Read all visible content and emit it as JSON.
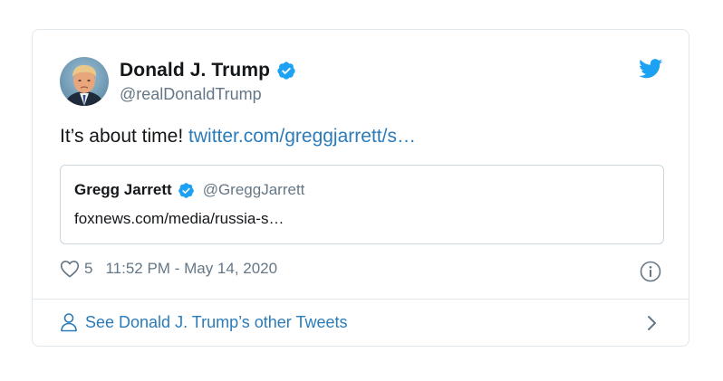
{
  "tweet": {
    "author_name": "Donald J. Trump",
    "author_handle": "@realDonaldTrump",
    "text": "It’s about time! ",
    "link_text": "twitter.com/greggjarrett/s…",
    "likes": "5",
    "timestamp": "11:52 PM - May 14, 2020"
  },
  "quoted": {
    "author_name": "Gregg Jarrett",
    "author_handle": "@GreggJarrett",
    "text": "foxnews.com/media/russia-s…"
  },
  "footer": {
    "link_text": "See Donald J. Trump’s other Tweets"
  },
  "icons": {
    "verified": "verified-badge-icon",
    "twitter": "twitter-bird-icon",
    "like": "heart-icon",
    "info": "info-icon",
    "person": "person-icon",
    "chevron": "chevron-right-icon"
  },
  "colors": {
    "link": "#2b7bb9",
    "verified": "#1da1f2",
    "secondary_text": "#657786",
    "border": "#e1e8ed"
  }
}
